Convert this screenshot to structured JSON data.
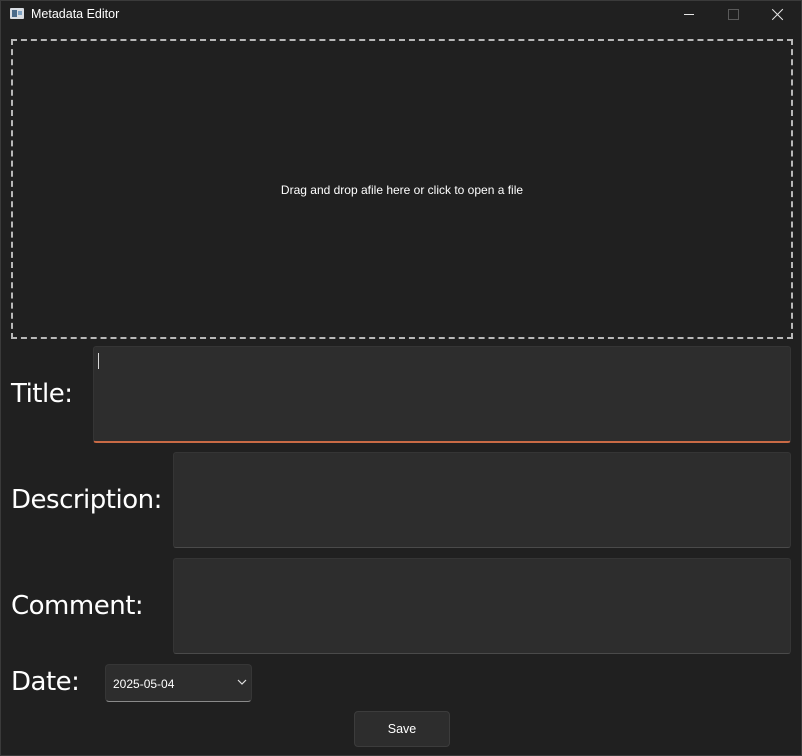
{
  "window": {
    "title": "Metadata Editor",
    "icon": "app-window-icon"
  },
  "titlebar_buttons": {
    "minimize": "minimize-icon",
    "maximize": "maximize-icon",
    "close": "close-icon"
  },
  "dropzone": {
    "text": "Drag and drop afile here or click to open a file"
  },
  "form": {
    "title_label": "Title:",
    "description_label": "Description:",
    "comment_label": "Comment:",
    "date_label": "Date:",
    "title_value": "",
    "description_value": "",
    "comment_value": "",
    "date_value": "2025-05-04",
    "date_dropdown_icon": "chevron-down-icon"
  },
  "actions": {
    "save_label": "Save"
  },
  "colors": {
    "background": "#202020",
    "field_background": "#2d2d2d",
    "focus_accent": "#c96a45",
    "dropzone_border": "#b8b8b8"
  }
}
